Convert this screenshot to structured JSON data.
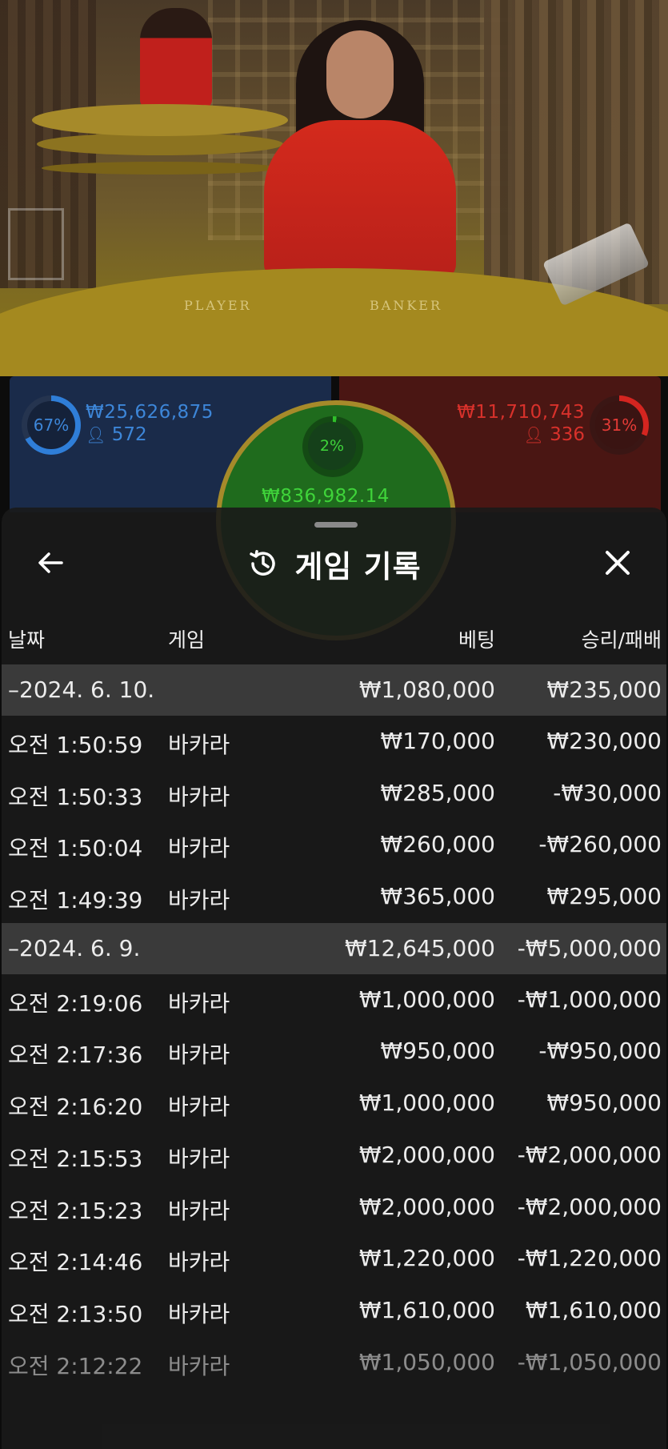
{
  "live_table": {
    "felt_player_label": "PLAYER",
    "felt_banker_label": "BANKER",
    "player": {
      "percent": "67%",
      "amount": "₩25,626,875",
      "count": "572",
      "color": "#3d86d8"
    },
    "banker": {
      "percent": "31%",
      "amount": "₩11,710,743",
      "count": "336",
      "color": "#d8312b"
    },
    "tie": {
      "percent": "2%",
      "amount": "₩836,982.14",
      "color": "#3fd43a"
    }
  },
  "sheet": {
    "title": "게임 기록",
    "icons": {
      "back": "arrow-left-icon",
      "history": "history-clock-icon",
      "close": "close-icon"
    },
    "columns": {
      "date": "날짜",
      "game": "게임",
      "bet": "베팅",
      "result": "승리/패배"
    },
    "rows": [
      {
        "type": "group",
        "date": "–2024. 6. 10.",
        "game": "",
        "bet": "₩1,080,000",
        "result": "₩235,000"
      },
      {
        "type": "item",
        "date": "오전 1:50:59",
        "game": "바카라",
        "bet": "₩170,000",
        "result": "₩230,000"
      },
      {
        "type": "item",
        "date": "오전 1:50:33",
        "game": "바카라",
        "bet": "₩285,000",
        "result": "-₩30,000"
      },
      {
        "type": "item",
        "date": "오전 1:50:04",
        "game": "바카라",
        "bet": "₩260,000",
        "result": "-₩260,000"
      },
      {
        "type": "item",
        "date": "오전 1:49:39",
        "game": "바카라",
        "bet": "₩365,000",
        "result": "₩295,000"
      },
      {
        "type": "group",
        "date": "–2024. 6. 9.",
        "game": "",
        "bet": "₩12,645,000",
        "result": "-₩5,000,000"
      },
      {
        "type": "item",
        "date": "오전 2:19:06",
        "game": "바카라",
        "bet": "₩1,000,000",
        "result": "-₩1,000,000"
      },
      {
        "type": "item",
        "date": "오전 2:17:36",
        "game": "바카라",
        "bet": "₩950,000",
        "result": "-₩950,000"
      },
      {
        "type": "item",
        "date": "오전 2:16:20",
        "game": "바카라",
        "bet": "₩1,000,000",
        "result": "₩950,000"
      },
      {
        "type": "item",
        "date": "오전 2:15:53",
        "game": "바카라",
        "bet": "₩2,000,000",
        "result": "-₩2,000,000"
      },
      {
        "type": "item",
        "date": "오전 2:15:23",
        "game": "바카라",
        "bet": "₩2,000,000",
        "result": "-₩2,000,000"
      },
      {
        "type": "item",
        "date": "오전 2:14:46",
        "game": "바카라",
        "bet": "₩1,220,000",
        "result": "-₩1,220,000"
      },
      {
        "type": "item",
        "date": "오전 2:13:50",
        "game": "바카라",
        "bet": "₩1,610,000",
        "result": "₩1,610,000"
      },
      {
        "type": "item",
        "date": "오전 2:12:22",
        "game": "바카라",
        "bet": "₩1,050,000",
        "result": "-₩1,050,000"
      }
    ]
  }
}
